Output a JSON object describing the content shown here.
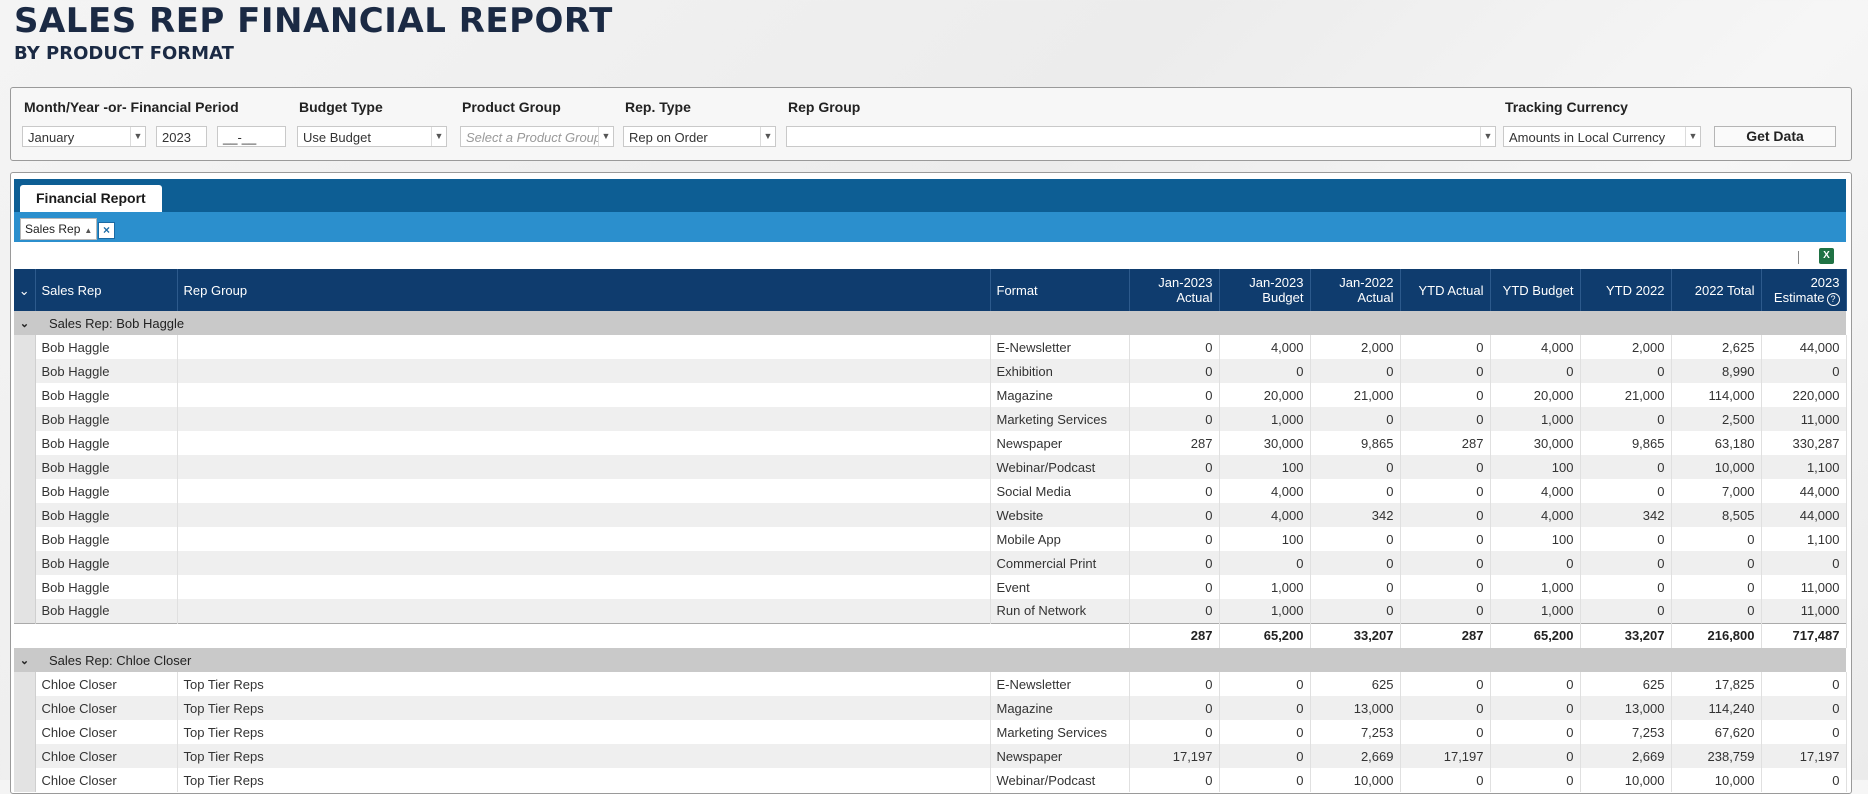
{
  "header": {
    "title": "SALES REP FINANCIAL REPORT",
    "subtitle": "BY PRODUCT FORMAT"
  },
  "filters": {
    "period": {
      "label": "Month/Year -or- Financial Period",
      "month": "January",
      "year": "2023",
      "financial_period_placeholder": "__-__"
    },
    "budget_type": {
      "label": "Budget Type",
      "value": "Use Budget"
    },
    "product_group": {
      "label": "Product Group",
      "placeholder": "Select a Product Group"
    },
    "rep_type": {
      "label": "Rep. Type",
      "value": "Rep on Order"
    },
    "rep_group": {
      "label": "Rep Group",
      "value": ""
    },
    "tracking_currency": {
      "label": "Tracking Currency",
      "value": "Amounts in Local Currency"
    },
    "get_data_label": "Get Data",
    "dropdown_arrow_icon": "chevron-down-icon"
  },
  "report": {
    "tab_label": "Financial Report",
    "grouping_chip": "Sales Rep",
    "grouping_chip_remove_glyph": "×",
    "export_icon": "excel-icon",
    "columns": {
      "sales_rep": "Sales Rep",
      "rep_group": "Rep Group",
      "format": "Format",
      "jan2023_actual": [
        "Jan-2023",
        "Actual"
      ],
      "jan2023_budget": [
        "Jan-2023",
        "Budget"
      ],
      "jan2022_actual": [
        "Jan-2022",
        "Actual"
      ],
      "ytd_actual": "YTD Actual",
      "ytd_budget": "YTD Budget",
      "ytd_2022": "YTD 2022",
      "total_2022": "2022 Total",
      "estimate_2023": [
        "2023",
        "Estimate"
      ]
    },
    "groups": [
      {
        "label": "Sales Rep: Bob Haggle",
        "rows": [
          [
            "Bob Haggle",
            "",
            "E-Newsletter",
            "0",
            "4,000",
            "2,000",
            "0",
            "4,000",
            "2,000",
            "2,625",
            "44,000"
          ],
          [
            "Bob Haggle",
            "",
            "Exhibition",
            "0",
            "0",
            "0",
            "0",
            "0",
            "0",
            "8,990",
            "0"
          ],
          [
            "Bob Haggle",
            "",
            "Magazine",
            "0",
            "20,000",
            "21,000",
            "0",
            "20,000",
            "21,000",
            "114,000",
            "220,000"
          ],
          [
            "Bob Haggle",
            "",
            "Marketing Services",
            "0",
            "1,000",
            "0",
            "0",
            "1,000",
            "0",
            "2,500",
            "11,000"
          ],
          [
            "Bob Haggle",
            "",
            "Newspaper",
            "287",
            "30,000",
            "9,865",
            "287",
            "30,000",
            "9,865",
            "63,180",
            "330,287"
          ],
          [
            "Bob Haggle",
            "",
            "Webinar/Podcast",
            "0",
            "100",
            "0",
            "0",
            "100",
            "0",
            "10,000",
            "1,100"
          ],
          [
            "Bob Haggle",
            "",
            "Social Media",
            "0",
            "4,000",
            "0",
            "0",
            "4,000",
            "0",
            "7,000",
            "44,000"
          ],
          [
            "Bob Haggle",
            "",
            "Website",
            "0",
            "4,000",
            "342",
            "0",
            "4,000",
            "342",
            "8,505",
            "44,000"
          ],
          [
            "Bob Haggle",
            "",
            "Mobile App",
            "0",
            "100",
            "0",
            "0",
            "100",
            "0",
            "0",
            "1,100"
          ],
          [
            "Bob Haggle",
            "",
            "Commercial Print",
            "0",
            "0",
            "0",
            "0",
            "0",
            "0",
            "0",
            "0"
          ],
          [
            "Bob Haggle",
            "",
            "Event",
            "0",
            "1,000",
            "0",
            "0",
            "1,000",
            "0",
            "0",
            "11,000"
          ],
          [
            "Bob Haggle",
            "",
            "Run of Network",
            "0",
            "1,000",
            "0",
            "0",
            "1,000",
            "0",
            "0",
            "11,000"
          ]
        ],
        "totals": [
          "287",
          "65,200",
          "33,207",
          "287",
          "65,200",
          "33,207",
          "216,800",
          "717,487"
        ]
      },
      {
        "label": "Sales Rep: Chloe Closer",
        "rows": [
          [
            "Chloe Closer",
            "Top Tier Reps",
            "E-Newsletter",
            "0",
            "0",
            "625",
            "0",
            "0",
            "625",
            "17,825",
            "0"
          ],
          [
            "Chloe Closer",
            "Top Tier Reps",
            "Magazine",
            "0",
            "0",
            "13,000",
            "0",
            "0",
            "13,000",
            "114,240",
            "0"
          ],
          [
            "Chloe Closer",
            "Top Tier Reps",
            "Marketing Services",
            "0",
            "0",
            "7,253",
            "0",
            "0",
            "7,253",
            "67,620",
            "0"
          ],
          [
            "Chloe Closer",
            "Top Tier Reps",
            "Newspaper",
            "17,197",
            "0",
            "2,669",
            "17,197",
            "0",
            "2,669",
            "238,759",
            "17,197"
          ],
          [
            "Chloe Closer",
            "Top Tier Reps",
            "Webinar/Podcast",
            "0",
            "0",
            "10,000",
            "0",
            "0",
            "10,000",
            "10,000",
            "0"
          ]
        ],
        "totals": null
      }
    ]
  }
}
